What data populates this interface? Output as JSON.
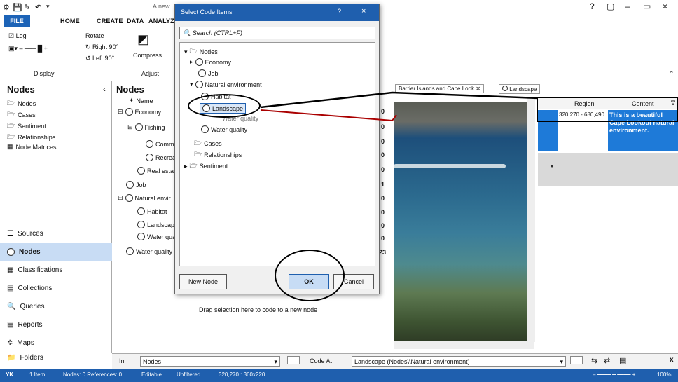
{
  "window": {
    "title_partial": "A new",
    "help": "?",
    "restore": "▢",
    "min": "–",
    "max": "▭",
    "close": "×"
  },
  "ribbon_tabs": [
    "FILE",
    "HOME",
    "CREATE",
    "DATA",
    "ANALYZE"
  ],
  "ribbon": {
    "log_label": "Log",
    "rotate_label": "Rotate",
    "right90": "Right 90°",
    "left90": "Left 90°",
    "compress": "Compress",
    "group_display": "Display",
    "group_adjust": "Adjust"
  },
  "nav": {
    "header": "Nodes",
    "tree": [
      "Nodes",
      "Cases",
      "Sentiment",
      "Relationships",
      "Node Matrices"
    ],
    "buttons": [
      "Sources",
      "Nodes",
      "Classifications",
      "Collections",
      "Queries",
      "Reports",
      "Maps",
      "Folders"
    ]
  },
  "nodes": {
    "header": "Nodes",
    "col_name": "Name",
    "rows": [
      "Economy",
      "Fishing",
      "Comm",
      "Recrea",
      "Real estat",
      "Job",
      "Natural envir",
      "Habitat",
      "Landscap",
      "Water qua",
      "Water quality"
    ],
    "nums": [
      "0",
      "0",
      "0",
      "0",
      "0",
      "1",
      "0",
      "0",
      "0",
      "0",
      "23"
    ]
  },
  "dialog": {
    "title": "Select Code Items",
    "question": "?",
    "close": "×",
    "search_placeholder": "Search (CTRL+F)",
    "tree": [
      "Nodes",
      "Economy",
      "Job",
      "Natural environment",
      "Habitat",
      "Landscape",
      "Water quality",
      "Water quality",
      "Cases",
      "Relationships",
      "Sentiment"
    ],
    "new_node": "New Node",
    "ok": "OK",
    "cancel": "Cancel"
  },
  "drag_hint": "Drag selection here to code to a new node",
  "media": {
    "tab1": "Barrier Islands and Cape Look",
    "tab2": "Landscape"
  },
  "table": {
    "col_region": "Region",
    "col_content": "Content",
    "region": "320,270 - 680,490",
    "content": "This is a beautiful Cape Lookout natural environment.",
    "newrow": "*"
  },
  "bottom": {
    "in_label": "In",
    "in_value": "Nodes",
    "code_at_label": "Code At",
    "code_at_value": "Landscape (Nodes\\\\Natural environment)",
    "dots": "...",
    "close": "x"
  },
  "status": {
    "user": "YK",
    "items": "1 Item",
    "nodes_refs": "Nodes: 0  References: 0",
    "editable": "Editable",
    "unfiltered": "Unfiltered",
    "coords": "320,270 : 360x220",
    "zoom": "100%"
  },
  "colors": {
    "accent": "#1f5fae",
    "selected": "#1e7ad8"
  }
}
